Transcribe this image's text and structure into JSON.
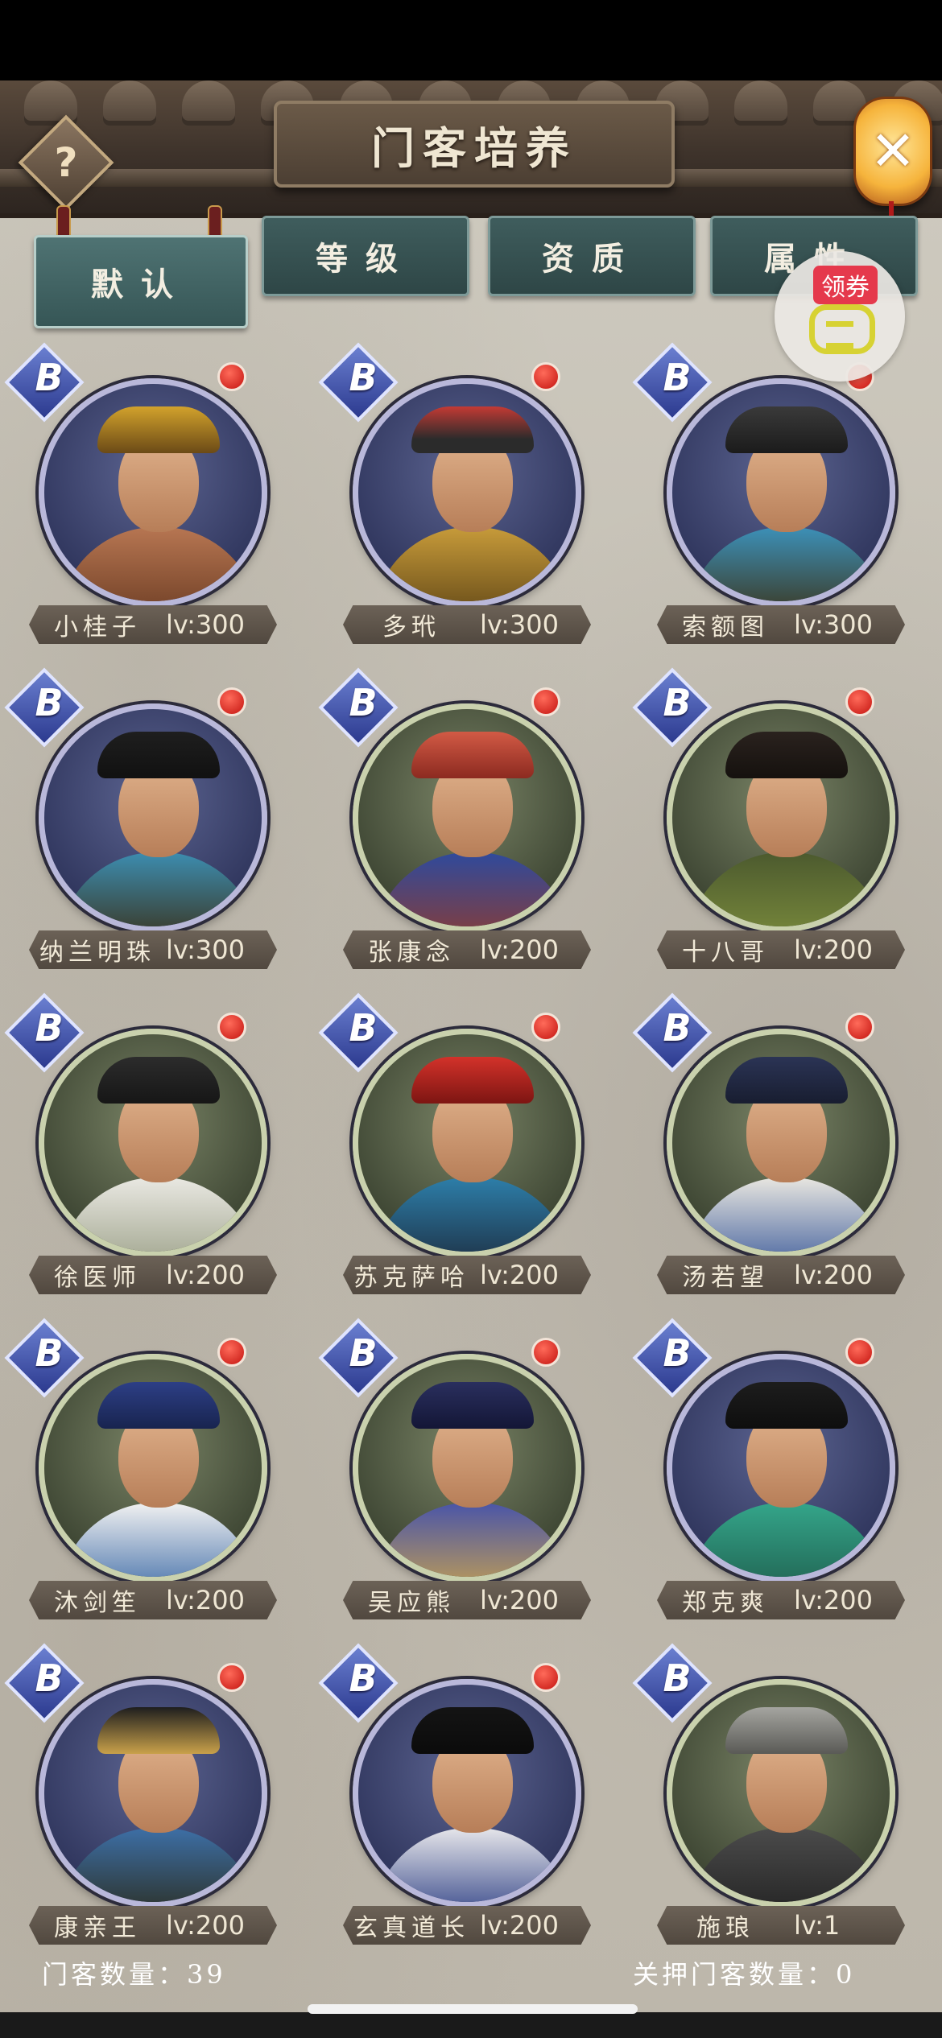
{
  "header": {
    "title": "门客培养",
    "help_label": "?",
    "close_label": "✕"
  },
  "tabs": [
    {
      "label": "默认",
      "active": true
    },
    {
      "label": "等级",
      "active": false
    },
    {
      "label": "资质",
      "active": false
    },
    {
      "label": "属性",
      "active": false
    }
  ],
  "coupon": {
    "badge": "领券"
  },
  "grade_letter": "B",
  "retainers": [
    {
      "name": "小桂子",
      "level": "lv:300"
    },
    {
      "name": "多玳",
      "level": "lv:300"
    },
    {
      "name": "索额图",
      "level": "lv:300"
    },
    {
      "name": "纳兰明珠",
      "level": "lv:300"
    },
    {
      "name": "张康念",
      "level": "lv:200"
    },
    {
      "name": "十八哥",
      "level": "lv:200"
    },
    {
      "name": "徐医师",
      "level": "lv:200"
    },
    {
      "name": "苏克萨哈",
      "level": "lv:200"
    },
    {
      "name": "汤若望",
      "level": "lv:200"
    },
    {
      "name": "沐剑笙",
      "level": "lv:200"
    },
    {
      "name": "吴应熊",
      "level": "lv:200"
    },
    {
      "name": "郑克爽",
      "level": "lv:200"
    },
    {
      "name": "康亲王",
      "level": "lv:200"
    },
    {
      "name": "玄真道长",
      "level": "lv:200"
    },
    {
      "name": "施琅",
      "level": "lv:1"
    }
  ],
  "footer": {
    "count_text": "门客数量：39",
    "jailed_text": "关押门客数量：0"
  }
}
